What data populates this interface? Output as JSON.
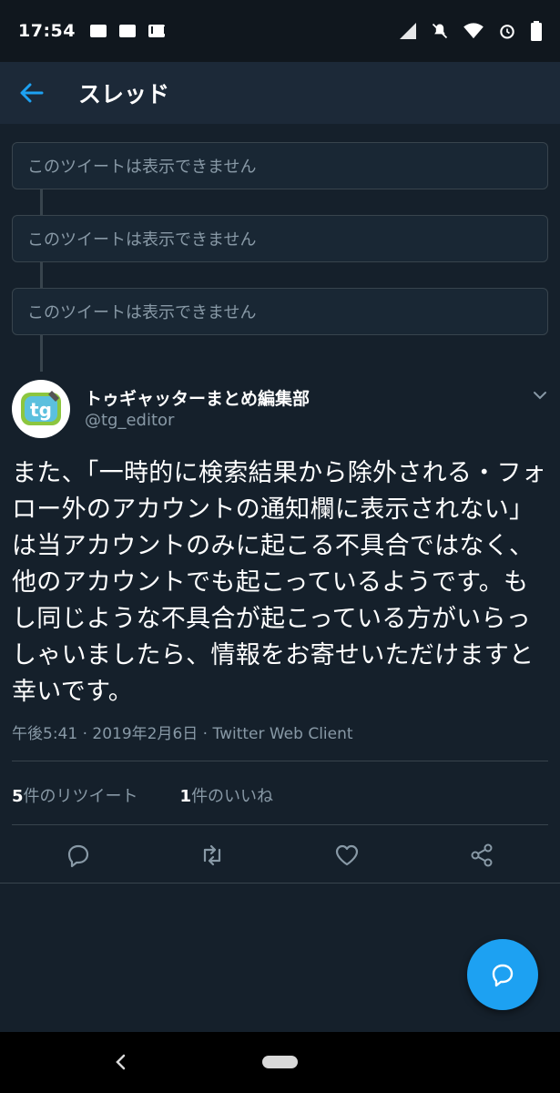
{
  "status_bar": {
    "time": "17:54",
    "icons": [
      "id-icon",
      "id-icon",
      "gmail-icon",
      "signal-icon",
      "mute-icon",
      "wifi-icon",
      "alarm-icon",
      "battery-icon"
    ]
  },
  "header": {
    "title": "スレッド"
  },
  "unavailable_tweets": [
    {
      "text": "このツイートは表示できません"
    },
    {
      "text": "このツイートは表示できません"
    },
    {
      "text": "このツイートは表示できません"
    }
  ],
  "tweet": {
    "author_name": "トゥギャッターまとめ編集部",
    "author_handle": "@tg_editor",
    "avatar_text": "tg",
    "text": "また、「一時的に検索結果から除外される・フォロー外のアカウントの通知欄に表示されない」は当アカウントのみに起こる不具合ではなく、他のアカウントでも起こっているようです。もし同じような不具合が起こっている方がいらっしゃいましたら、情報をお寄せいただけますと幸いです。",
    "meta": "午後5:41 · 2019年2月6日 · Twitter Web Client",
    "retweets": {
      "count": "5",
      "label": "件のリツイート"
    },
    "likes": {
      "count": "1",
      "label": "件のいいね"
    }
  },
  "colors": {
    "background": "#15202b",
    "accent": "#1da1f2",
    "muted": "#8899a6",
    "border": "#38444d"
  }
}
